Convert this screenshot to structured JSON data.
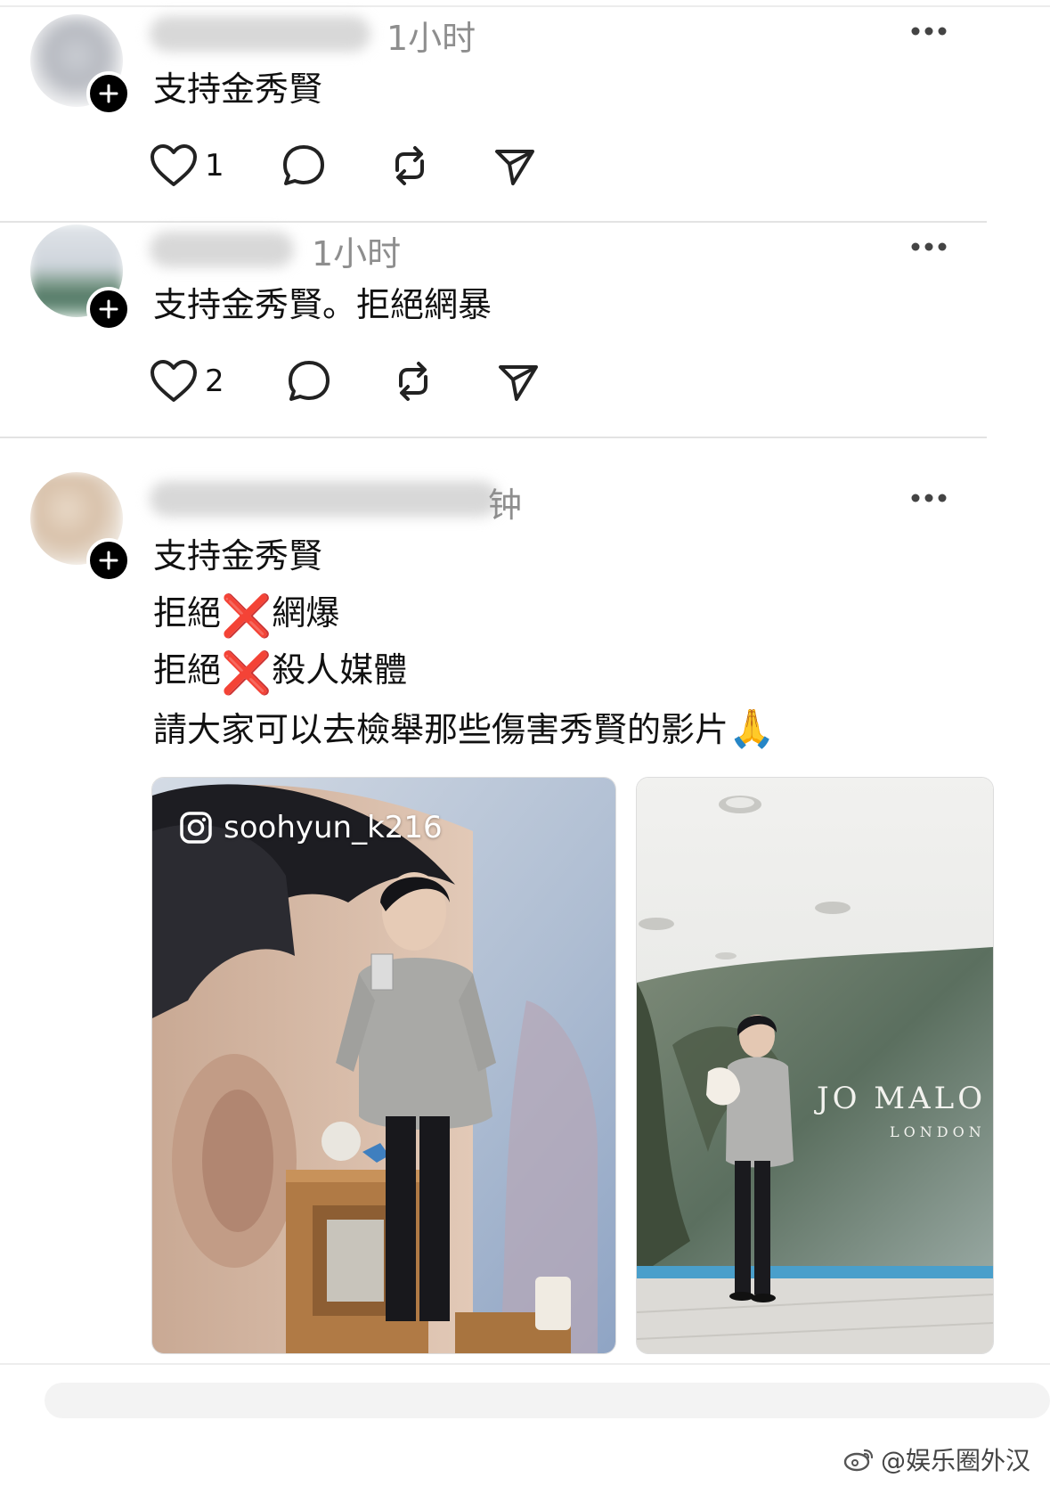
{
  "posts": [
    {
      "time": "1小时",
      "text_lines": [
        "支持金秀賢"
      ],
      "likes": "1",
      "icons": [
        "heart-icon",
        "comment-icon",
        "repost-icon",
        "share-icon",
        "more-icon",
        "follow-plus-icon"
      ]
    },
    {
      "time": "1小时",
      "text_lines": [
        "支持金秀賢。拒絕網暴"
      ],
      "likes": "2"
    },
    {
      "time": "钟",
      "text_lines": [
        "支持金秀賢",
        "拒絕",
        "網爆",
        "拒絕",
        "殺人媒體",
        "請大家可以去檢舉那些傷害秀賢的影片"
      ],
      "emoji_x": "❌",
      "emoji_pray": "🙏",
      "photo1_tag": "soohyun_k216",
      "photo2_brand": "JO MALO",
      "photo2_brand_sub": "LONDON"
    }
  ],
  "watermark": "@娱乐圈外汉",
  "colors": {
    "divider": "#e3e3e3",
    "muted": "#8e8e8e",
    "x_red": "#e0242b"
  }
}
